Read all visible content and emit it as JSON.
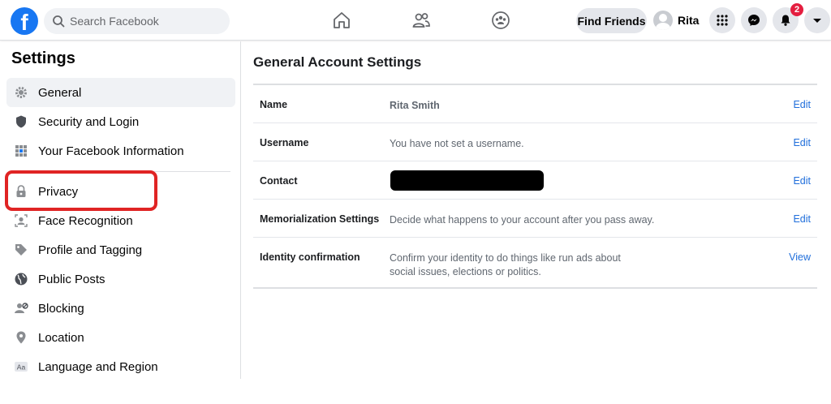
{
  "header": {
    "search_placeholder": "Search Facebook",
    "find_friends": "Find Friends",
    "profile_name": "Rita",
    "notification_count": "2",
    "icons": [
      "facebook-logo",
      "search-icon",
      "home-icon",
      "friends-icon",
      "groups-icon",
      "menu-grid-icon",
      "messenger-icon",
      "notifications-icon",
      "caret-down-icon"
    ],
    "brand_color": "#1877f2",
    "badge_color": "#e41e3f"
  },
  "sidebar": {
    "title": "Settings",
    "items": [
      {
        "label": "General",
        "icon": "gear-icon",
        "active": true
      },
      {
        "label": "Security and Login",
        "icon": "shield-icon",
        "active": false
      },
      {
        "label": "Your Facebook Information",
        "icon": "facebook-info-icon",
        "active": false
      },
      {
        "label": "Privacy",
        "icon": "lock-icon",
        "active": false
      },
      {
        "label": "Face Recognition",
        "icon": "face-recognition-icon",
        "active": false
      },
      {
        "label": "Profile and Tagging",
        "icon": "tag-icon",
        "active": false
      },
      {
        "label": "Public Posts",
        "icon": "globe-icon",
        "active": false
      },
      {
        "label": "Blocking",
        "icon": "blocking-icon",
        "active": false
      },
      {
        "label": "Location",
        "icon": "location-pin-icon",
        "active": false
      },
      {
        "label": "Language and Region",
        "icon": "language-icon",
        "active": false
      }
    ],
    "highlight_color": "#e02424"
  },
  "main": {
    "title": "General Account Settings",
    "rows": [
      {
        "label": "Name",
        "value": "Rita Smith",
        "action": "Edit"
      },
      {
        "label": "Username",
        "value": "You have not set a username.",
        "action": "Edit"
      },
      {
        "label": "Contact",
        "value": "",
        "action": "Edit"
      },
      {
        "label": "Memorialization Settings",
        "value": "Decide what happens to your account after you pass away.",
        "action": "Edit"
      },
      {
        "label": "Identity confirmation",
        "value_line1": "Confirm your identity to do things like run ads about",
        "value_line2": "social issues, elections or politics.",
        "action": "View"
      }
    ],
    "link_color": "#216fdb"
  }
}
